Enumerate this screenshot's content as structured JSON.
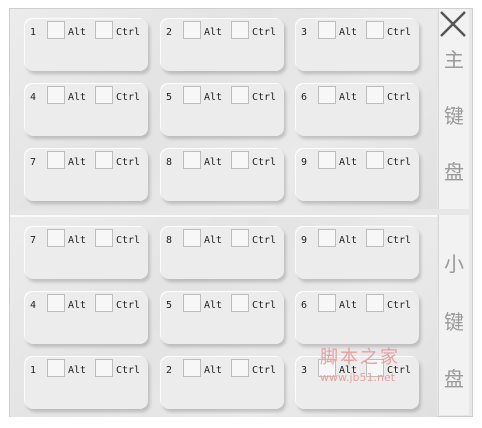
{
  "main_keyboard": {
    "label_chars": [
      "主",
      "键",
      "盘"
    ],
    "keys": [
      {
        "num": "1",
        "alt": "Alt",
        "ctrl": "Ctrl"
      },
      {
        "num": "2",
        "alt": "Alt",
        "ctrl": "Ctrl"
      },
      {
        "num": "3",
        "alt": "Alt",
        "ctrl": "Ctrl"
      },
      {
        "num": "4",
        "alt": "Alt",
        "ctrl": "Ctrl"
      },
      {
        "num": "5",
        "alt": "Alt",
        "ctrl": "Ctrl"
      },
      {
        "num": "6",
        "alt": "Alt",
        "ctrl": "Ctrl"
      },
      {
        "num": "7",
        "alt": "Alt",
        "ctrl": "Ctrl"
      },
      {
        "num": "8",
        "alt": "Alt",
        "ctrl": "Ctrl"
      },
      {
        "num": "9",
        "alt": "Alt",
        "ctrl": "Ctrl"
      }
    ]
  },
  "small_keyboard": {
    "label_chars": [
      "小",
      "键",
      "盘"
    ],
    "keys": [
      {
        "num": "7",
        "alt": "Alt",
        "ctrl": "Ctrl"
      },
      {
        "num": "8",
        "alt": "Alt",
        "ctrl": "Ctrl"
      },
      {
        "num": "9",
        "alt": "Alt",
        "ctrl": "Ctrl"
      },
      {
        "num": "4",
        "alt": "Alt",
        "ctrl": "Ctrl"
      },
      {
        "num": "5",
        "alt": "Alt",
        "ctrl": "Ctrl"
      },
      {
        "num": "6",
        "alt": "Alt",
        "ctrl": "Ctrl"
      },
      {
        "num": "1",
        "alt": "Alt",
        "ctrl": "Ctrl"
      },
      {
        "num": "2",
        "alt": "Alt",
        "ctrl": "Ctrl"
      },
      {
        "num": "3",
        "alt": "Alt",
        "ctrl": "Ctrl"
      }
    ]
  },
  "close_icon": "close-icon",
  "watermark": {
    "title": "脚本之家",
    "url": "www.jb51.net"
  },
  "colors": {
    "panel_bg": "#e7e7e7",
    "card_bg": "#ececec",
    "sidebar_text": "#9a9a9a",
    "watermark": "#e8a0a0"
  }
}
